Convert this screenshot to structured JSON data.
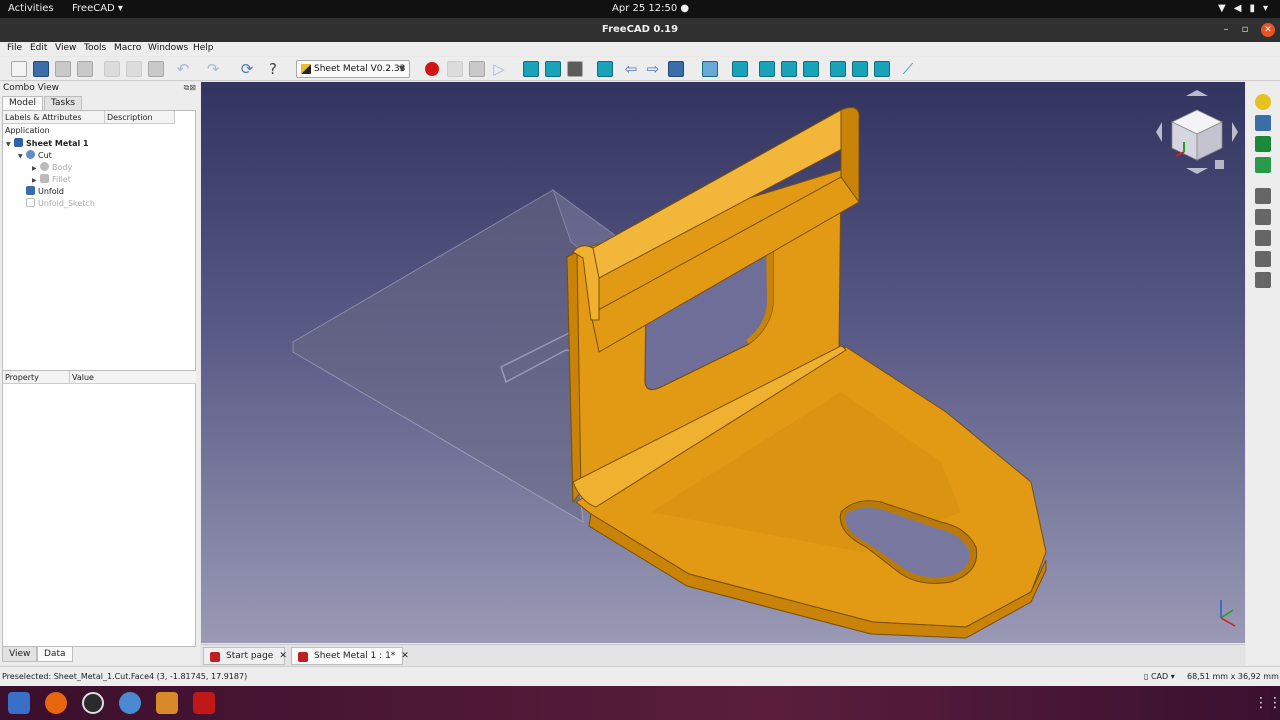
{
  "system_bar": {
    "activities": "Activities",
    "app_menu": "FreeCAD ▾",
    "clock": "Apr 25  12:50 ●"
  },
  "window": {
    "title": "FreeCAD 0.19"
  },
  "menu": [
    "File",
    "Edit",
    "View",
    "Tools",
    "Macro",
    "Windows",
    "Help"
  ],
  "toolbar": {
    "workbench": "Sheet Metal V0.2.33"
  },
  "combo_view": {
    "title": "Combo View",
    "tabs": [
      "Model",
      "Tasks"
    ],
    "tree_columns": [
      "Labels & Attributes",
      "Description"
    ],
    "tree_root": "Application",
    "tree": [
      {
        "label": "Sheet Metal 1"
      },
      {
        "label": "Cut"
      },
      {
        "label": "Body"
      },
      {
        "label": "Fillet"
      },
      {
        "label": "Unfold"
      },
      {
        "label": "Unfold_Sketch"
      }
    ],
    "property_columns": [
      "Property",
      "Value"
    ],
    "bottom_tabs": [
      "View",
      "Data"
    ]
  },
  "doc_tabs": [
    {
      "label": "Start page"
    },
    {
      "label": "Sheet Metal 1 : 1*"
    }
  ],
  "status": {
    "message": "Preselected: Sheet_Metal_1.Cut.Face4 (3, -1.81745, 17.9187)",
    "nav_style": "CAD",
    "dimensions": "68,51 mm x 36,92 mm"
  },
  "colors": {
    "part_face": "#e29a14",
    "part_edge": "#c98309",
    "viewport_top": "#33335f",
    "viewport_bottom": "#9a9ab6"
  }
}
